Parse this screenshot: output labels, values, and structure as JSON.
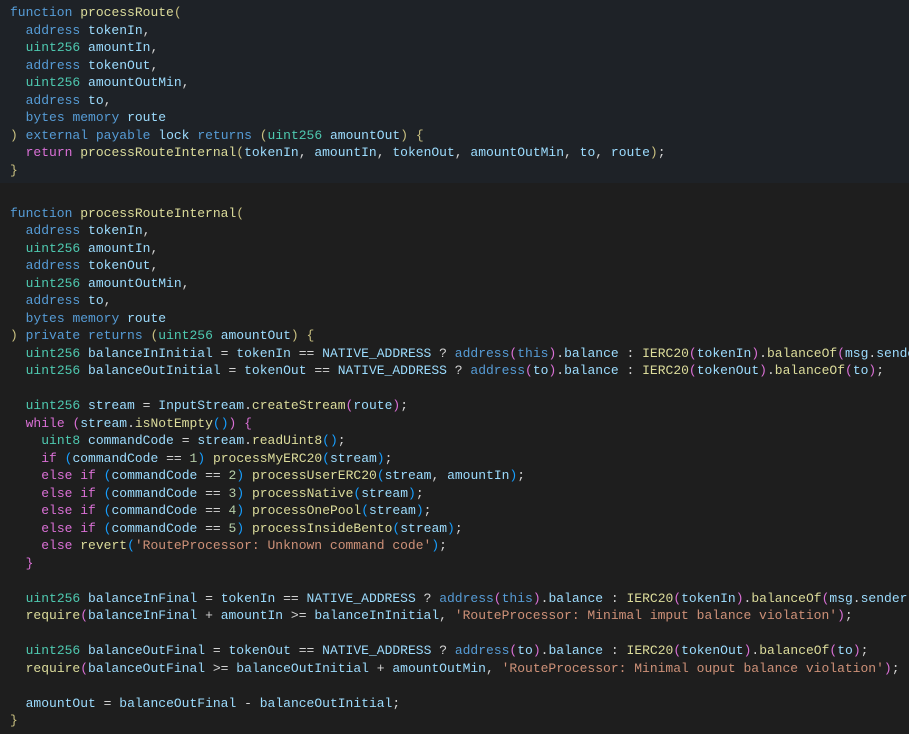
{
  "c": {
    "kw_function": "function",
    "fn_processRoute": "processRoute",
    "kw_address": "address",
    "id_tokenIn": "tokenIn",
    "kw_uint256": "uint256",
    "id_amountIn": "amountIn",
    "id_tokenOut": "tokenOut",
    "id_amountOutMin": "amountOutMin",
    "id_to": "to",
    "kw_bytes": "bytes",
    "kw_memory": "memory",
    "id_route": "route",
    "kw_external": "external",
    "kw_payable": "payable",
    "id_lock": "lock",
    "kw_returns": "returns",
    "id_amountOut": "amountOut",
    "kw_return": "return",
    "fn_processRouteInternal": "processRouteInternal",
    "kw_private": "private",
    "id_balanceInInitial": "balanceInInitial",
    "id_NATIVE_ADDRESS": "NATIVE_ADDRESS",
    "kw_this": "this",
    "id_balance": "balance",
    "id_IERC20": "IERC20",
    "fn_balanceOf": "balanceOf",
    "id_msg": "msg",
    "id_sender": "sender",
    "id_balanceOutInitial": "balanceOutInitial",
    "id_stream": "stream",
    "id_InputStream": "InputStream",
    "fn_createStream": "createStream",
    "kw_while": "while",
    "fn_isNotEmpty": "isNotEmpty",
    "kw_uint8": "uint8",
    "id_commandCode": "commandCode",
    "fn_readUint8": "readUint8",
    "kw_if": "if",
    "fn_processMyERC20": "processMyERC20",
    "kw_else": "else",
    "fn_processUserERC20": "processUserERC20",
    "fn_processNative": "processNative",
    "fn_processOnePool": "processOnePool",
    "fn_processInsideBento": "processInsideBento",
    "fn_revert": "revert",
    "str_unknown": "'RouteProcessor: Unknown command code'",
    "id_balanceInFinal": "balanceInFinal",
    "fn_require": "require",
    "str_min_in": "'RouteProcessor: Minimal imput balance violation'",
    "id_balanceOutFinal": "balanceOutFinal",
    "str_min_out": "'RouteProcessor: Minimal ouput balance violation'",
    "n1": "1",
    "n2": "2",
    "n3": "3",
    "n4": "4",
    "n5": "5"
  }
}
